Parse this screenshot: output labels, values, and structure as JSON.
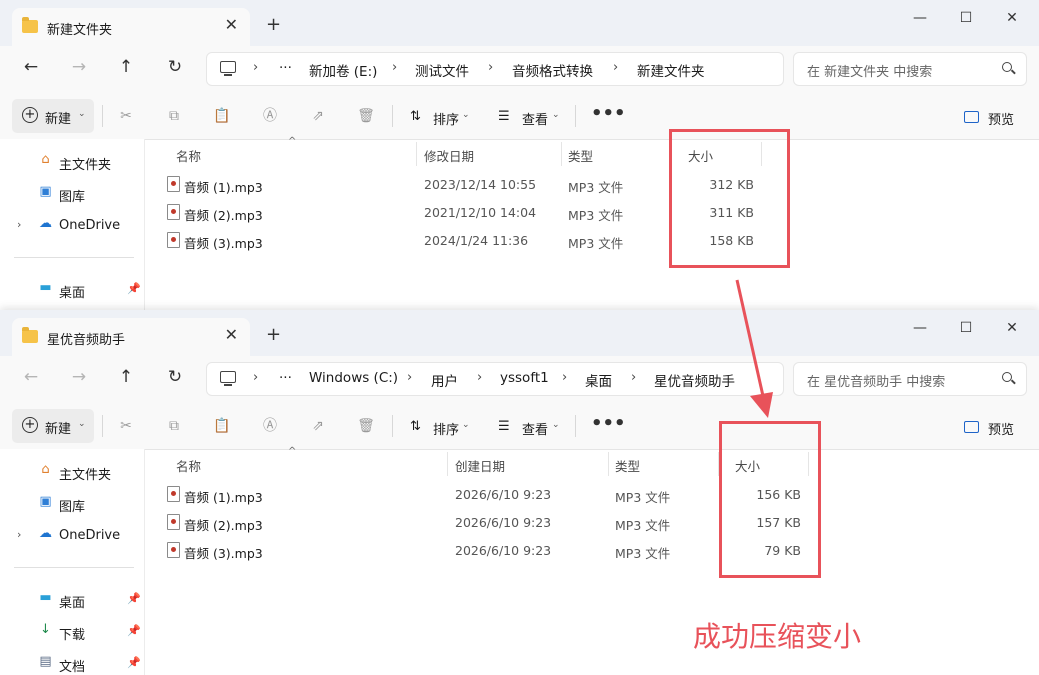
{
  "colors": {
    "highlight": "#e8525a",
    "folder": "#f6c349",
    "chrome": "#eef1f6"
  },
  "common": {
    "new_label": "新建",
    "sort_label": "排序",
    "view_label": "查看",
    "preview_label": "预览",
    "col_name": "名称",
    "col_type": "类型",
    "col_size": "大小",
    "more": "•••",
    "ellipsis": "···",
    "sidebar": {
      "home": "主文件夹",
      "gallery": "图库",
      "onedrive": "OneDrive",
      "desktop": "桌面",
      "downloads": "下载",
      "documents": "文档"
    }
  },
  "window1": {
    "tab_title": "新建文件夹",
    "breadcrumbs": [
      "新加卷 (E:)",
      "测试文件",
      "音频格式转换",
      "新建文件夹"
    ],
    "search_placeholder": "在 新建文件夹 中搜索",
    "col_date": "修改日期",
    "files": [
      {
        "name": "音频 (1).mp3",
        "date": "2023/12/14 10:55",
        "type": "MP3 文件",
        "size": "312 KB"
      },
      {
        "name": "音频 (2).mp3",
        "date": "2021/12/10 14:04",
        "type": "MP3 文件",
        "size": "311 KB"
      },
      {
        "name": "音频 (3).mp3",
        "date": "2024/1/24 11:36",
        "type": "MP3 文件",
        "size": "158 KB"
      }
    ]
  },
  "window2": {
    "tab_title": "星优音频助手",
    "breadcrumbs": [
      "Windows (C:)",
      "用户",
      "yssoft1",
      "桌面",
      "星优音频助手"
    ],
    "search_placeholder": "在 星优音频助手 中搜索",
    "col_date": "创建日期",
    "files": [
      {
        "name": "音频 (1).mp3",
        "date": "2026/6/10 9:23",
        "type": "MP3 文件",
        "size": "156 KB"
      },
      {
        "name": "音频 (2).mp3",
        "date": "2026/6/10 9:23",
        "type": "MP3 文件",
        "size": "157 KB"
      },
      {
        "name": "音频 (3).mp3",
        "date": "2026/6/10 9:23",
        "type": "MP3 文件",
        "size": "79 KB"
      }
    ]
  },
  "annotation": {
    "caption": "成功压缩变小"
  }
}
